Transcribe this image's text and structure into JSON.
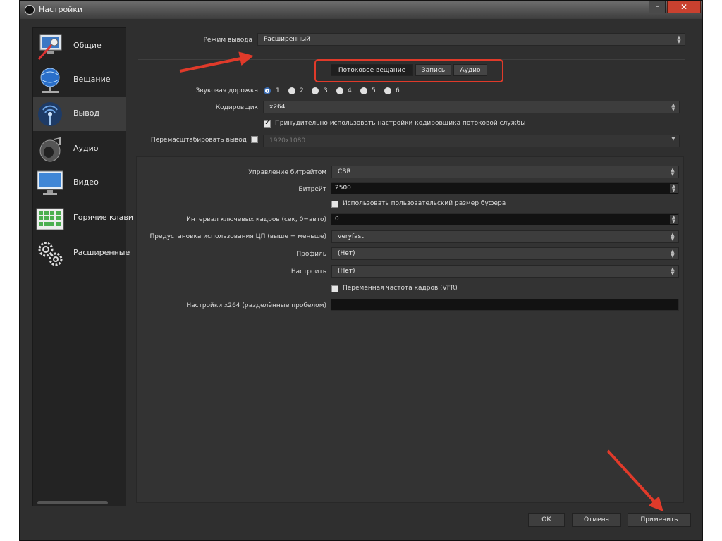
{
  "window": {
    "title": "Настройки",
    "minimize_glyph": "–",
    "close_glyph": "✕"
  },
  "sidebar": {
    "items": [
      {
        "label": "Общие",
        "icon": "general-monitor-icon"
      },
      {
        "label": "Вещание",
        "icon": "globe-network-icon"
      },
      {
        "label": "Вывод",
        "icon": "broadcast-antenna-icon",
        "active": true
      },
      {
        "label": "Аудио",
        "icon": "speaker-icon"
      },
      {
        "label": "Видео",
        "icon": "monitor-icon"
      },
      {
        "label": "Горячие клави",
        "icon": "keyboard-icon"
      },
      {
        "label": "Расширенные",
        "icon": "gears-icon"
      }
    ]
  },
  "output_mode": {
    "label": "Режим вывода",
    "value": "Расширенный"
  },
  "tabs": [
    {
      "label": "Потоковое вещание",
      "active": true
    },
    {
      "label": "Запись",
      "active": false
    },
    {
      "label": "Аудио",
      "active": false
    }
  ],
  "audio_track": {
    "label": "Звуковая дорожка",
    "options": [
      "1",
      "2",
      "3",
      "4",
      "5",
      "6"
    ],
    "selected": "1"
  },
  "encoder": {
    "label": "Кодировщик",
    "value": "x264"
  },
  "enforce_service": {
    "label": "Принудительно использовать настройки кодировщика потоковой службы",
    "checked": true
  },
  "rescale": {
    "label": "Перемасштабировать вывод",
    "checked": false,
    "value": "1920x1080"
  },
  "bitrate_control": {
    "label": "Управление битрейтом",
    "value": "CBR"
  },
  "bitrate": {
    "label": "Битрейт",
    "value": "2500"
  },
  "custom_buffer": {
    "label": "Использовать пользовательский размер буфера",
    "checked": false
  },
  "keyframe_interval": {
    "label": "Интервал ключевых кадров (сек, 0=авто)",
    "value": "0"
  },
  "cpu_preset": {
    "label": "Предустановка использования ЦП (выше = меньше)",
    "value": "veryfast"
  },
  "profile": {
    "label": "Профиль",
    "value": "(Нет)"
  },
  "tune": {
    "label": "Настроить",
    "value": "(Нет)"
  },
  "vfr": {
    "label": "Переменная частота кадров (VFR)",
    "checked": false
  },
  "x264_opts": {
    "label": "Настройки x264 (разделённые пробелом)",
    "value": ""
  },
  "buttons": {
    "ok": "ОК",
    "cancel": "Отмена",
    "apply": "Применить"
  },
  "colors": {
    "annotation_red": "#e03a2a",
    "window_bg": "#2f2f2f"
  }
}
